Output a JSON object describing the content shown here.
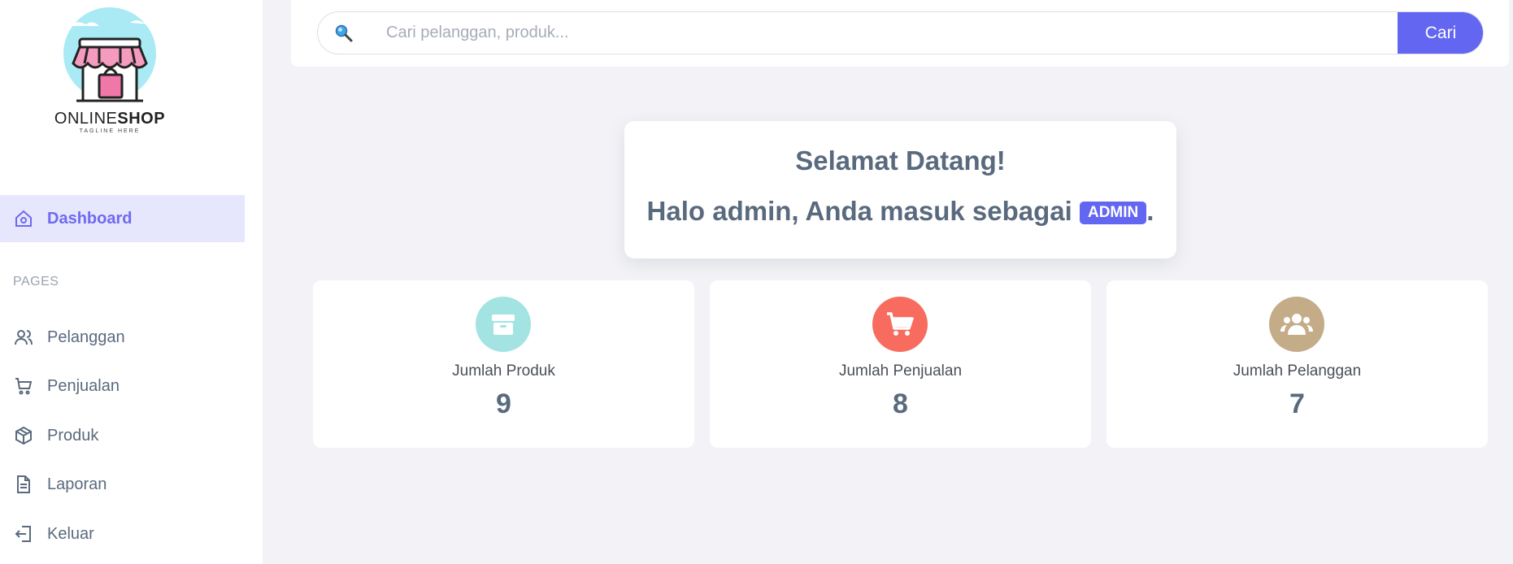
{
  "logo": {
    "word1": "ONLINE",
    "word2": "SHOP",
    "tagline": "TAGLINE HERE"
  },
  "sidebar": {
    "dashboard": {
      "label": "Dashboard",
      "icon": "home-icon"
    },
    "section_label": "PAGES",
    "items": [
      {
        "label": "Pelanggan",
        "icon": "users-icon"
      },
      {
        "label": "Penjualan",
        "icon": "cart-icon"
      },
      {
        "label": "Produk",
        "icon": "box-icon"
      },
      {
        "label": "Laporan",
        "icon": "document-icon"
      },
      {
        "label": "Keluar",
        "icon": "logout-icon"
      }
    ]
  },
  "search": {
    "placeholder": "Cari pelanggan, produk...",
    "value": "",
    "button_label": "Cari"
  },
  "welcome": {
    "title": "Selamat Datang!",
    "greeting": "Halo admin, Anda masuk sebagai",
    "role": "ADMIN",
    "suffix": "."
  },
  "stats": [
    {
      "label": "Jumlah Produk",
      "value": "9",
      "color": "#a3e4e2",
      "icon": "box-icon"
    },
    {
      "label": "Jumlah Penjualan",
      "value": "8",
      "color": "#f76c5e",
      "icon": "cart-icon"
    },
    {
      "label": "Jumlah Pelanggan",
      "value": "7",
      "color": "#c4ac88",
      "icon": "users-icon"
    }
  ],
  "colors": {
    "accent": "#6366f1",
    "active_bg": "#e6e6fd",
    "background": "#f3f3f7"
  }
}
